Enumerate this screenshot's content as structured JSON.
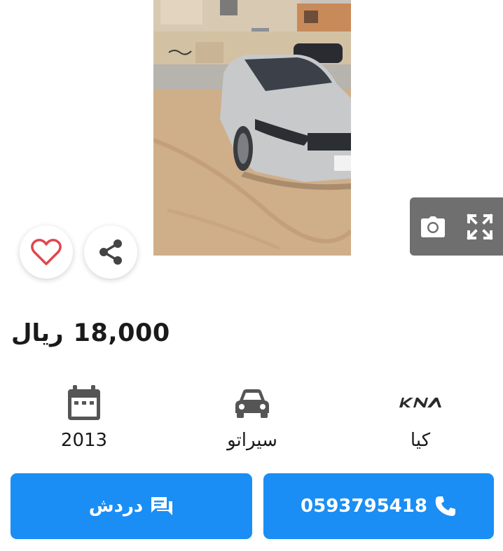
{
  "listing": {
    "photo_alt": "silver sedan parked on sandy ground"
  },
  "gallery": {
    "camera_icon": "camera-icon",
    "fullscreen_icon": "expand-icon"
  },
  "actions_top": {
    "favorite_icon": "heart-icon",
    "share_icon": "share-icon"
  },
  "price": {
    "amount": "18,000",
    "currency": "ريال"
  },
  "specs": [
    {
      "icon": "calendar-icon",
      "value": "2013"
    },
    {
      "icon": "car-icon",
      "value": "سيراتو"
    },
    {
      "icon": "kia-logo-icon",
      "value": "كيا"
    }
  ],
  "buttons": {
    "chat_label": "دردش",
    "call_label": "0593795418"
  },
  "colors": {
    "accent": "#1a8ef4",
    "favorite": "#e0474c",
    "overlay": "#6f6f6f"
  }
}
